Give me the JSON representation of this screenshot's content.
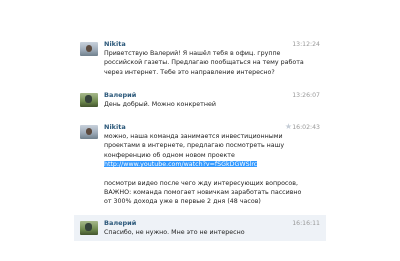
{
  "messages": [
    {
      "author": "Nikita",
      "time": "13:12:24",
      "lines": [
        "Приветствую Валерий! Я нашёл тебя в офиц. группе",
        "российской газеты. Предлагаю пообщаться на тему работа",
        "через интернет. Тебе это направление интересно?"
      ]
    },
    {
      "author": "Валерий",
      "time": "13:26:07",
      "lines": [
        "День добрый. Можно конкретней"
      ]
    },
    {
      "author": "Nikita",
      "time": "16:02:43",
      "lines": [
        "можно, наша команда занимается инвестиционными",
        "проектами в интернете, предлагаю посмотреть нашу",
        "конференцию об одном новом проекте"
      ],
      "link": "http://www.youtube.com/watch?v=fSGkDGWSlrc",
      "lines2": [
        "посмотри видео после чего жду интересующих вопросов,",
        "ВАЖНО: команда помогает новичкам заработать пассивно",
        "от 300% дохода уже в первые 2 дня (48 часов)"
      ]
    },
    {
      "author": "Валерий",
      "time": "16:16:11",
      "lines": [
        "Спасибо, не нужно. Мне это не интересно"
      ]
    }
  ]
}
